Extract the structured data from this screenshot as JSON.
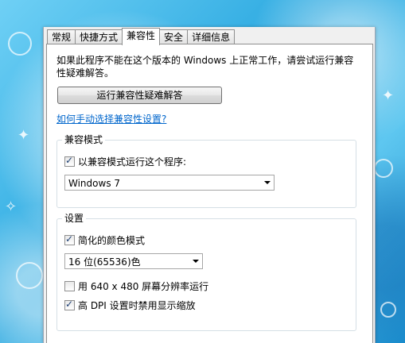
{
  "tabs": [
    {
      "label": "常规",
      "active": false
    },
    {
      "label": "快捷方式",
      "active": false
    },
    {
      "label": "兼容性",
      "active": true
    },
    {
      "label": "安全",
      "active": false
    },
    {
      "label": "详细信息",
      "active": false
    }
  ],
  "compat": {
    "description": "如果此程序不能在这个版本的 Windows 上正常工作，请尝试运行兼容性疑难解答。",
    "troubleshoot_button": "运行兼容性疑难解答",
    "manual_link": "如何手动选择兼容性设置?"
  },
  "compat_mode": {
    "title": "兼容模式",
    "checkbox_label": "以兼容模式运行这个程序:",
    "checked": true,
    "selected_os": "Windows 7"
  },
  "settings": {
    "title": "设置",
    "reduced_color_label": "简化的颜色模式",
    "reduced_color_checked": true,
    "color_value": "16 位(65536)色",
    "res_640_label": "用 640 x 480 屏幕分辨率运行",
    "res_640_checked": false,
    "dpi_label": "高 DPI 设置时禁用显示缩放",
    "dpi_checked": true
  },
  "colors": {
    "link": "#0066cc",
    "background": "#3fb4e6"
  },
  "icons": {
    "checkmark": "✓",
    "dropdown": "chevron-down-icon"
  }
}
